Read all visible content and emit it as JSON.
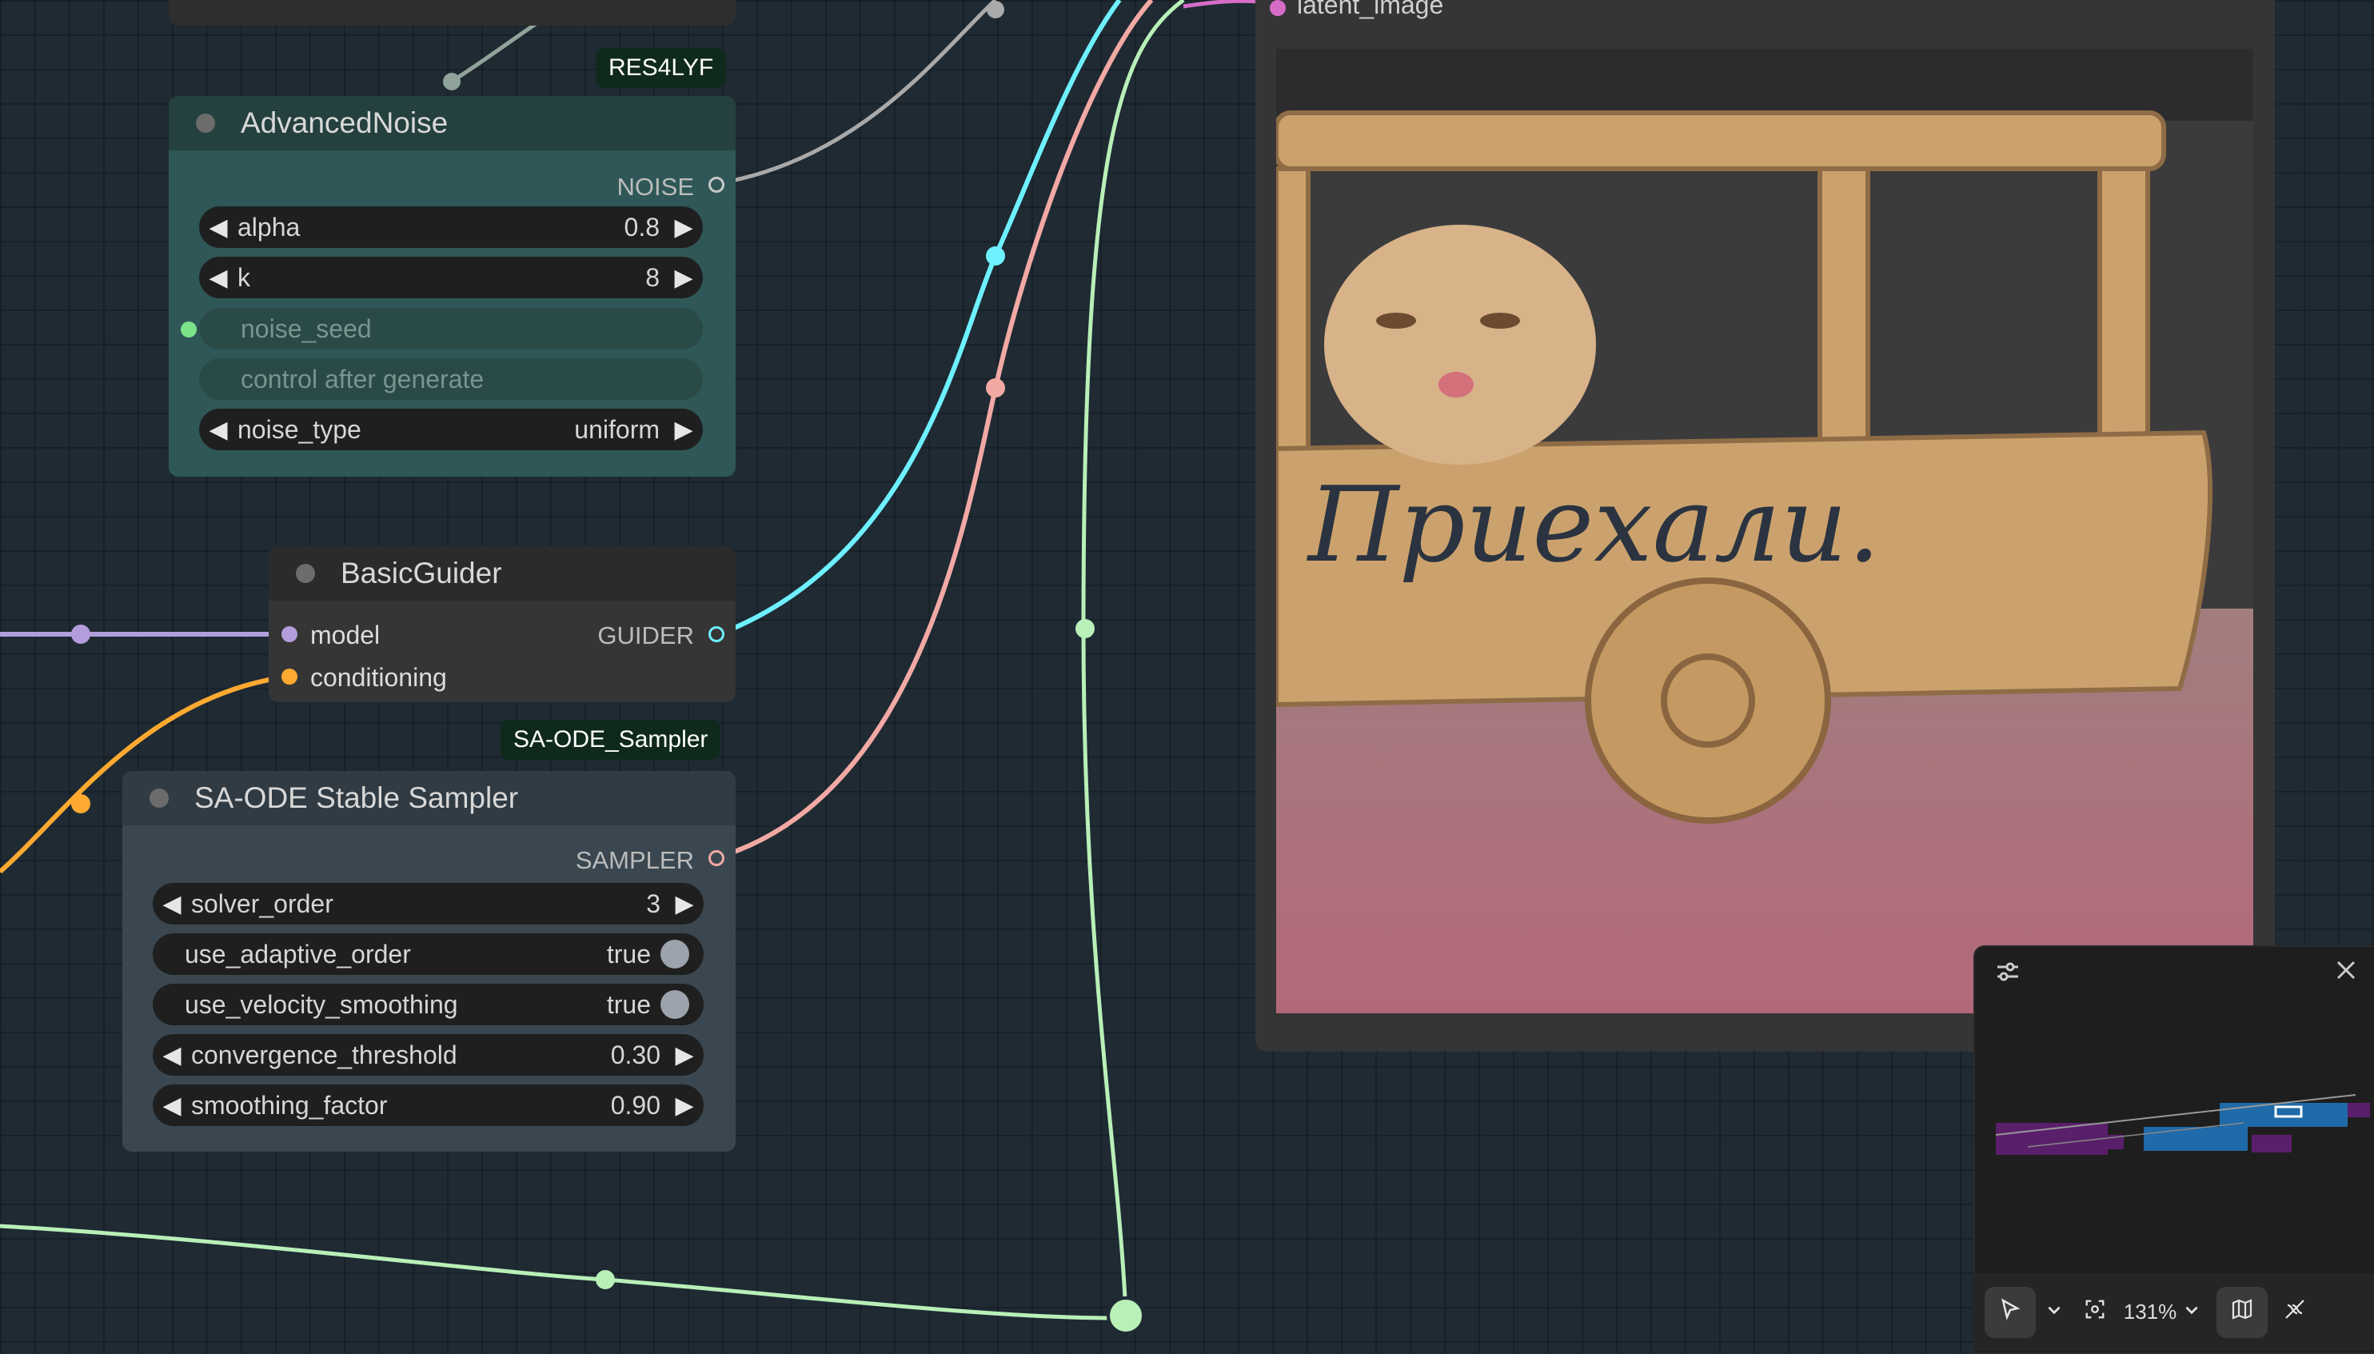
{
  "preview_node": {
    "input_label": "latent_image"
  },
  "advanced_noise": {
    "badge": "RES4LYF",
    "title": "AdvancedNoise",
    "output": "NOISE",
    "widgets": [
      {
        "name": "alpha",
        "value": "0.8"
      },
      {
        "name": "k",
        "value": "8"
      },
      {
        "name": "noise_seed"
      },
      {
        "name": "control after generate"
      },
      {
        "name": "noise_type",
        "value": "uniform"
      }
    ]
  },
  "basic_guider": {
    "title": "BasicGuider",
    "inputs": [
      "model",
      "conditioning"
    ],
    "output": "GUIDER"
  },
  "sa_ode": {
    "badge": "SA-ODE_Sampler",
    "title": "SA-ODE Stable Sampler",
    "output": "SAMPLER",
    "widgets": [
      {
        "name": "solver_order",
        "value": "3"
      },
      {
        "name": "use_adaptive_order",
        "value": "true"
      },
      {
        "name": "use_velocity_smoothing",
        "value": "true"
      },
      {
        "name": "convergence_threshold",
        "value": "0.30"
      },
      {
        "name": "smoothing_factor",
        "value": "0.90"
      }
    ]
  },
  "preview_image": {
    "caption_text": "Приехали."
  },
  "toolbar": {
    "zoom": "131%"
  },
  "colors": {
    "noise": "#a9a9a9",
    "guider": "#6ef0ff",
    "sampler": "#f2a9a4",
    "latent": "#b8f0b8",
    "model": "#b39ddb",
    "conditioning": "#ffa931",
    "image": "#d66cc8"
  },
  "icons": {
    "minimap_settings": "sliders-icon",
    "minimap_close": "close-icon",
    "select_tool": "pointer-icon",
    "fit_view": "fit-view-icon",
    "minimap_toggle": "map-icon",
    "link_visibility": "link-off-icon"
  }
}
